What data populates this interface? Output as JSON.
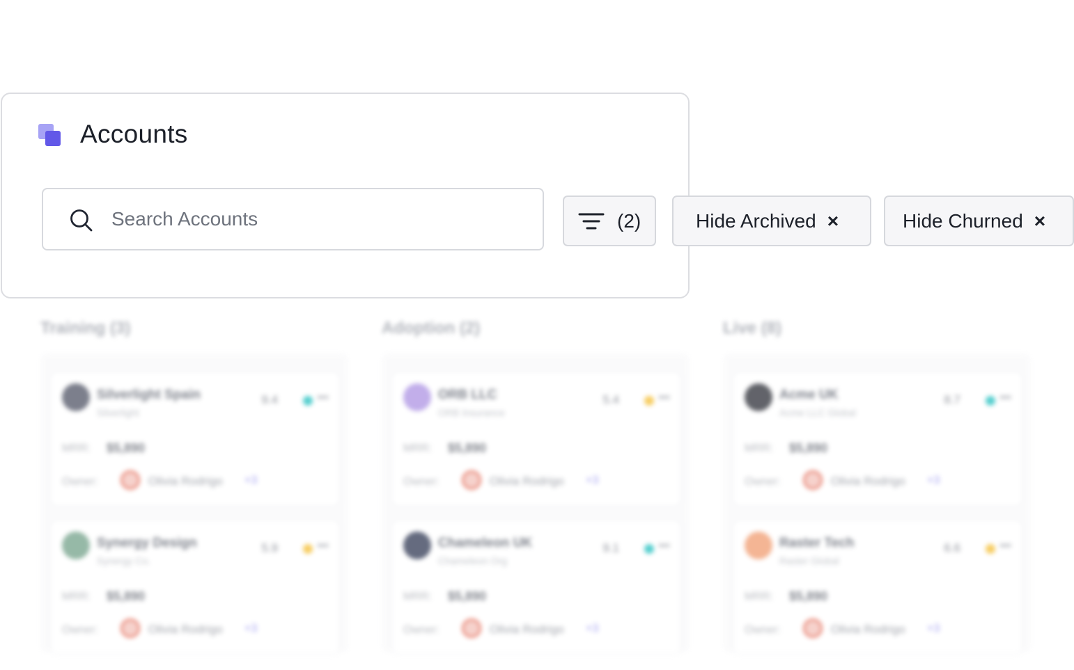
{
  "header": {
    "title": "Accounts"
  },
  "search": {
    "placeholder": "Search Accounts"
  },
  "filters": {
    "count_label": "(2)",
    "chips": [
      {
        "label": "Hide Archived",
        "close": "×"
      },
      {
        "label": "Hide Churned",
        "close": "×"
      }
    ]
  },
  "board": {
    "columns": [
      {
        "title": "Training (3)",
        "cards": [
          {
            "name": "Silverlight Spain",
            "sub": "Silverlight",
            "score": "9.4",
            "status_color": "#2ec4c4",
            "logo_color": "#5c6070",
            "mrr_label": "MRR:",
            "mrr": "$5,890",
            "owner_label": "Owner:",
            "owner": "Olivia Rodrigo",
            "owner_more": "+3",
            "more": "•••"
          },
          {
            "name": "Synergy Design",
            "sub": "Synergy Co.",
            "score": "5.9",
            "status_color": "#f6c23e",
            "logo_color": "#7da892",
            "mrr_label": "MRR:",
            "mrr": "$5,890",
            "owner_label": "Owner:",
            "owner": "Olivia Rodrigo",
            "owner_more": "+3",
            "more": "•••"
          }
        ]
      },
      {
        "title": "Adoption (2)",
        "cards": [
          {
            "name": "ORB LLC",
            "sub": "ORB Insurance",
            "score": "5.4",
            "status_color": "#f6c23e",
            "logo_color": "#b39be6",
            "mrr_label": "MRR:",
            "mrr": "$5,890",
            "owner_label": "Owner:",
            "owner": "Olivia Rodrigo",
            "owner_more": "+3",
            "more": "•••"
          },
          {
            "name": "Chameleon UK",
            "sub": "Chameleon Org",
            "score": "9.1",
            "status_color": "#2ec4c4",
            "logo_color": "#3f4760",
            "mrr_label": "MRR:",
            "mrr": "$5,890",
            "owner_label": "Owner:",
            "owner": "Olivia Rodrigo",
            "owner_more": "+3",
            "more": "•••"
          }
        ]
      },
      {
        "title": "Live (8)",
        "cards": [
          {
            "name": "Acme UK",
            "sub": "Acme LLC Global",
            "score": "8.7",
            "status_color": "#2ec4c4",
            "logo_color": "#3b3d45",
            "mrr_label": "MRR:",
            "mrr": "$5,890",
            "owner_label": "Owner:",
            "owner": "Olivia Rodrigo",
            "owner_more": "+3",
            "more": "•••"
          },
          {
            "name": "Raster Tech",
            "sub": "Raster Global",
            "score": "6.6",
            "status_color": "#f6c23e",
            "logo_color": "#f2a37a",
            "mrr_label": "MRR:",
            "mrr": "$5,890",
            "owner_label": "Owner:",
            "owner": "Olivia Rodrigo",
            "owner_more": "+3",
            "more": "•••"
          }
        ]
      }
    ]
  }
}
